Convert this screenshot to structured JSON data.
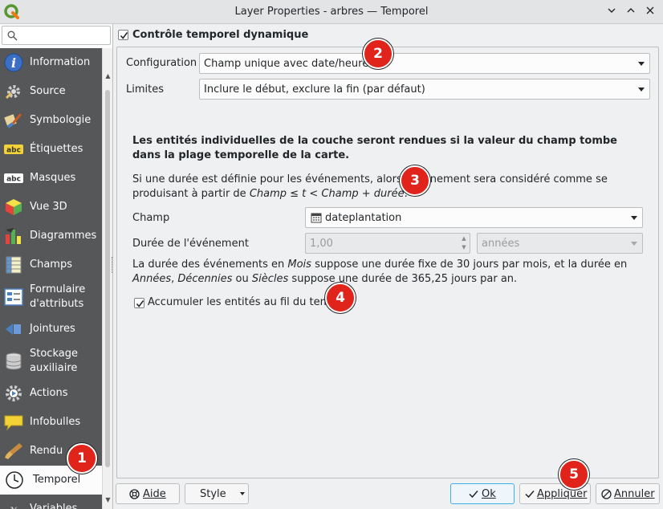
{
  "window": {
    "title": "Layer Properties - arbres — Temporel",
    "controls": [
      "minimize",
      "maximize",
      "close"
    ]
  },
  "sidebar": {
    "search_placeholder": "",
    "items": [
      {
        "label": "Information",
        "icon": "info-icon"
      },
      {
        "label": "Source",
        "icon": "source-icon"
      },
      {
        "label": "Symbologie",
        "icon": "symbology-icon"
      },
      {
        "label": "Étiquettes",
        "icon": "labels-icon"
      },
      {
        "label": "Masques",
        "icon": "masks-icon"
      },
      {
        "label": "Vue 3D",
        "icon": "3d-view-icon"
      },
      {
        "label": "Diagrammes",
        "icon": "diagrams-icon"
      },
      {
        "label": "Champs",
        "icon": "fields-icon"
      },
      {
        "label": "Formulaire d'attributs",
        "icon": "attribute-form-icon"
      },
      {
        "label": "Jointures",
        "icon": "joins-icon"
      },
      {
        "label": "Stockage auxiliaire",
        "icon": "auxiliary-storage-icon"
      },
      {
        "label": "Actions",
        "icon": "actions-icon"
      },
      {
        "label": "Infobulles",
        "icon": "tooltips-icon"
      },
      {
        "label": "Rendu",
        "icon": "rendering-icon"
      },
      {
        "label": "Temporel",
        "icon": "clock-icon",
        "active": true
      },
      {
        "label": "Variables",
        "icon": "variables-icon"
      }
    ]
  },
  "temporal": {
    "dynamic_toggle_label": "Contrôle temporel dynamique",
    "dynamic_toggle_checked": true,
    "configuration_label": "Configuration",
    "configuration_value": "Champ unique avec date/heure",
    "limits_label": "Limites",
    "limits_value": "Inclure le début, exclure la fin (par défaut)",
    "bold_description": "Les entités individuelles de la couche seront rendues si la valeur du champ tombe dans la plage temporelle de la carte.",
    "description_part1": "Si une durée est définie pour les événements, alors l'événement sera considéré comme se produisant à partir de ",
    "description_formula": "Champ ≤ t < Champ + durée",
    "description_end": ".",
    "field_label": "Champ",
    "field_value": "dateplantation",
    "field_icon": "calendar-icon",
    "duration_label": "Durée de l'événement",
    "duration_value": "1,00",
    "duration_unit": "années",
    "note_a": "La durée des événements en ",
    "note_months": "Mois",
    "note_b": " suppose une durée fixe de 30 jours par mois, et la durée en ",
    "note_years": "Années",
    "note_c": ", ",
    "note_decades": "Décennies",
    "note_d": " ou ",
    "note_centuries": "Siècles",
    "note_e": " suppose une durée de 365,25 jours par an.",
    "accumulate_label": "Accumuler les entités au fil du temps",
    "accumulate_checked": true
  },
  "annotations": [
    "1",
    "2",
    "3",
    "4",
    "5"
  ],
  "buttons": {
    "help": "Aide",
    "style": "Style",
    "ok": "Ok",
    "apply": "Appliquer",
    "cancel": "Annuler"
  },
  "colors": {
    "sidebar_bg": "#555759",
    "badge": "#e0241b",
    "focus": "#3daee9"
  }
}
